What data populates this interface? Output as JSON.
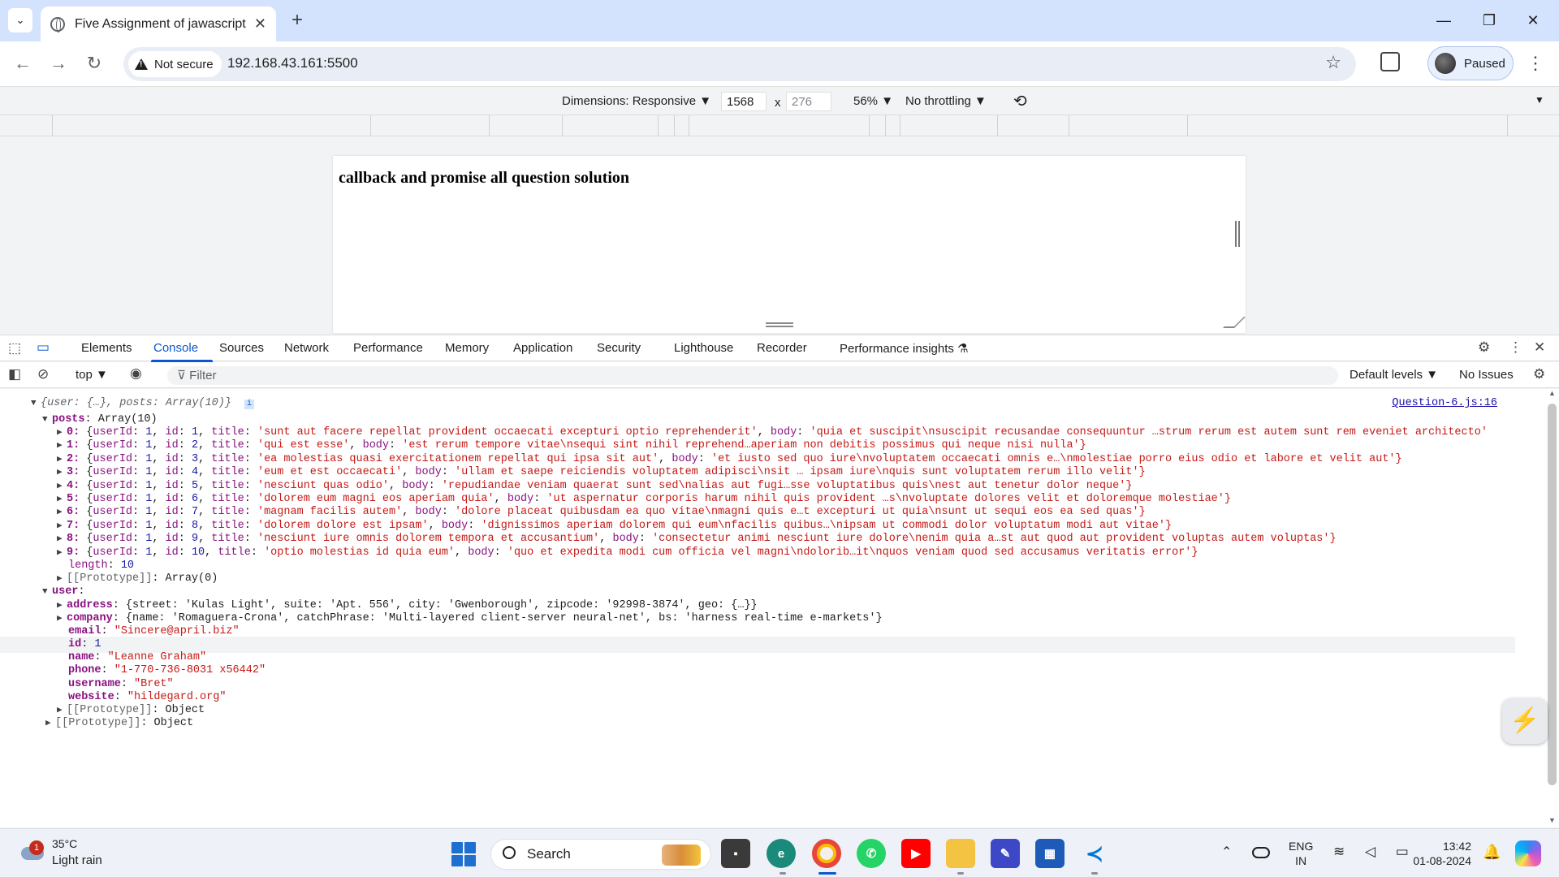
{
  "browser": {
    "tab_title": "Five Assignment of jawascript",
    "new_tab": "+",
    "security_label": "Not secure",
    "url": "192.168.43.161:5500",
    "profile_label": "Paused"
  },
  "device_toolbar": {
    "dimensions": "Dimensions: Responsive ▼",
    "width": "1568",
    "times": "x",
    "height": "276",
    "zoom": "56% ▼",
    "throttling": "No throttling ▼"
  },
  "page": {
    "heading": "callback and promise all question solution"
  },
  "devtools": {
    "tabs": [
      "Elements",
      "Console",
      "Sources",
      "Network",
      "Performance",
      "Memory",
      "Application",
      "Security",
      "Lighthouse",
      "Recorder",
      "Performance insights ⚗"
    ],
    "active_tab": "Console",
    "context": "top ▼",
    "filter_placeholder": "Filter",
    "levels": "Default levels ▼",
    "issues": "No Issues"
  },
  "console": {
    "source_link": "Question-6.js:16",
    "root_summary": "{user: {…}, posts: Array(10)}",
    "posts_label": "posts",
    "posts_type": "Array(10)",
    "posts": [
      {
        "idx": "0",
        "userId": "1",
        "id": "1",
        "title": "'sunt aut facere repellat provident occaecati excepturi optio reprehenderit'",
        "body": "'quia et suscipit\\nsuscipit recusandae consequuntur …strum rerum est autem sunt rem eveniet architecto'"
      },
      {
        "idx": "1",
        "userId": "1",
        "id": "2",
        "title": "'qui est esse'",
        "body": "'est rerum tempore vitae\\nsequi sint nihil reprehend…aperiam non debitis possimus qui neque nisi nulla'}"
      },
      {
        "idx": "2",
        "userId": "1",
        "id": "3",
        "title": "'ea molestias quasi exercitationem repellat qui ipsa sit aut'",
        "body": "'et iusto sed quo iure\\nvoluptatem occaecati omnis e…\\nmolestiae porro eius odio et labore et velit aut'}"
      },
      {
        "idx": "3",
        "userId": "1",
        "id": "4",
        "title": "'eum et est occaecati'",
        "body": "'ullam et saepe reiciendis voluptatem adipisci\\nsit … ipsam iure\\nquis sunt voluptatem rerum illo velit'}"
      },
      {
        "idx": "4",
        "userId": "1",
        "id": "5",
        "title": "'nesciunt quas odio'",
        "body": "'repudiandae veniam quaerat sunt sed\\nalias aut fugi…sse voluptatibus quis\\nest aut tenetur dolor neque'}"
      },
      {
        "idx": "5",
        "userId": "1",
        "id": "6",
        "title": "'dolorem eum magni eos aperiam quia'",
        "body": "'ut aspernatur corporis harum nihil quis provident …s\\nvoluptate dolores velit et doloremque molestiae'}"
      },
      {
        "idx": "6",
        "userId": "1",
        "id": "7",
        "title": "'magnam facilis autem'",
        "body": "'dolore placeat quibusdam ea quo vitae\\nmagni quis e…t excepturi ut quia\\nsunt ut sequi eos ea sed quas'}"
      },
      {
        "idx": "7",
        "userId": "1",
        "id": "8",
        "title": "'dolorem dolore est ipsam'",
        "body": "'dignissimos aperiam dolorem qui eum\\nfacilis quibus…\\nipsam ut commodi dolor voluptatum modi aut vitae'}"
      },
      {
        "idx": "8",
        "userId": "1",
        "id": "9",
        "title": "'nesciunt iure omnis dolorem tempora et accusantium'",
        "body": "'consectetur animi nesciunt iure dolore\\nenim quia a…st aut quod aut provident voluptas autem voluptas'}"
      },
      {
        "idx": "9",
        "userId": "1",
        "id": "10",
        "title": "'optio molestias id quia eum'",
        "body": "'quo et expedita modi cum officia vel magni\\ndolorib…it\\nquos veniam quod sed accusamus veritatis error'}"
      }
    ],
    "length_key": "length",
    "length_val": "10",
    "proto_key": "[[Prototype]]",
    "proto_array": "Array(0)",
    "user_label": "user",
    "address": "{street: 'Kulas Light', suite: 'Apt. 556', city: 'Gwenborough', zipcode: '92998-3874', geo: {…}}",
    "company": "{name: 'Romaguera-Crona', catchPhrase: 'Multi-layered client-server neural-net', bs: 'harness real-time e-markets'}",
    "email": "\"Sincere@april.biz\"",
    "id": "1",
    "name": "\"Leanne Graham\"",
    "phone": "\"1-770-736-8031 x56442\"",
    "username": "\"Bret\"",
    "website": "\"hildegard.org\"",
    "proto_object": "Object"
  },
  "taskbar": {
    "weather_badge": "1",
    "temperature": "35°C",
    "condition": "Light rain",
    "search": "Search",
    "lang_top": "ENG",
    "lang_bottom": "IN",
    "time": "13:42",
    "date": "01-08-2024"
  },
  "colors": {
    "accent": "#0b57d0",
    "string": "#c41a16",
    "number": "#1a1aa6",
    "key": "#881280"
  }
}
